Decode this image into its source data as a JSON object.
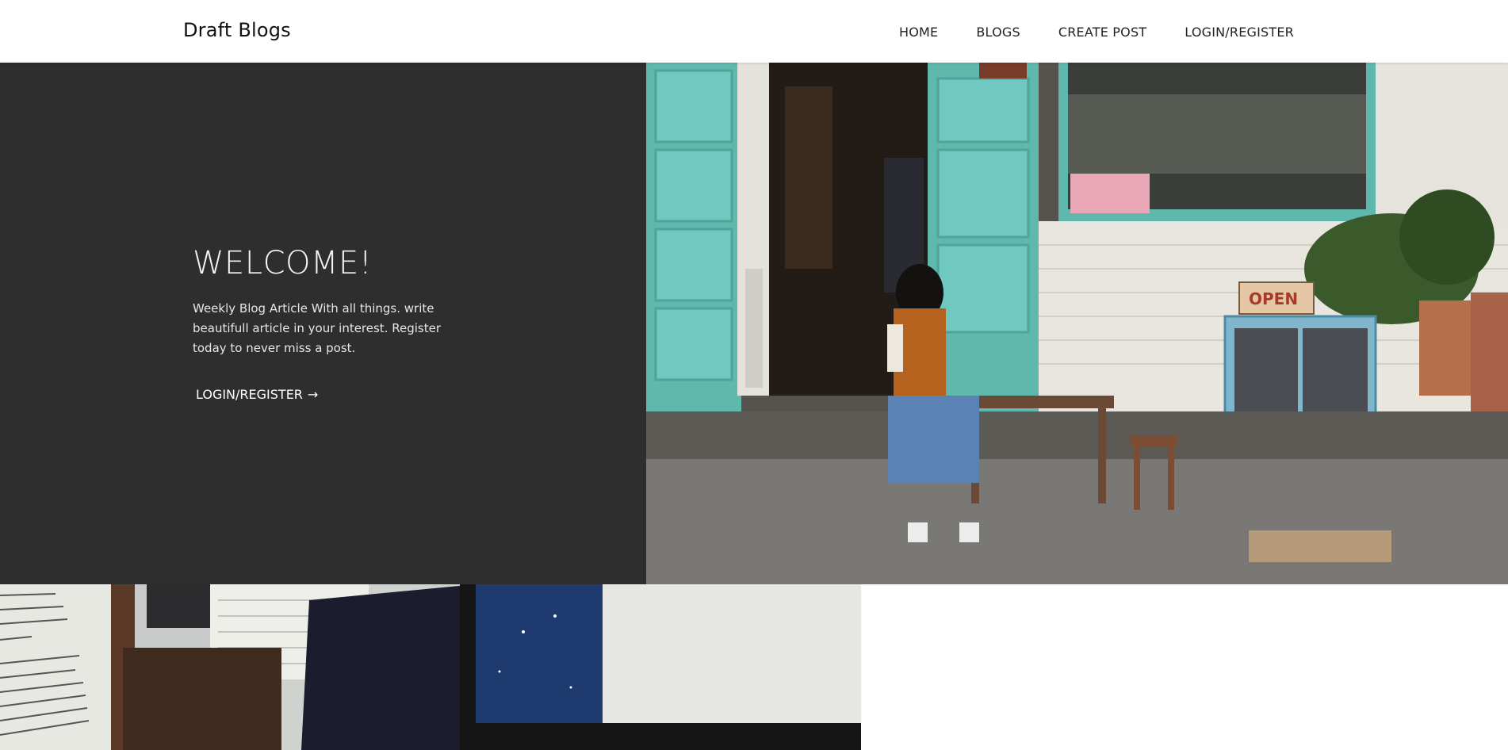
{
  "header": {
    "brand": "Draft Blogs",
    "nav": [
      "HOME",
      "BLOGS",
      "CREATE POST",
      "LOGIN/REGISTER"
    ]
  },
  "hero": {
    "title": "WELCOME!",
    "text": "Weekly Blog Article With all things. write beautifull article in your interest. Register today to never miss a post.",
    "cta_label": "LOGIN/REGISTER",
    "cta_icon": "arrow-right-icon",
    "image_sign": "OPEN"
  },
  "colors": {
    "hero_bg": "#2e2e2e",
    "teal_door": "#6fc9c1",
    "header_bg": "#ffffff"
  }
}
